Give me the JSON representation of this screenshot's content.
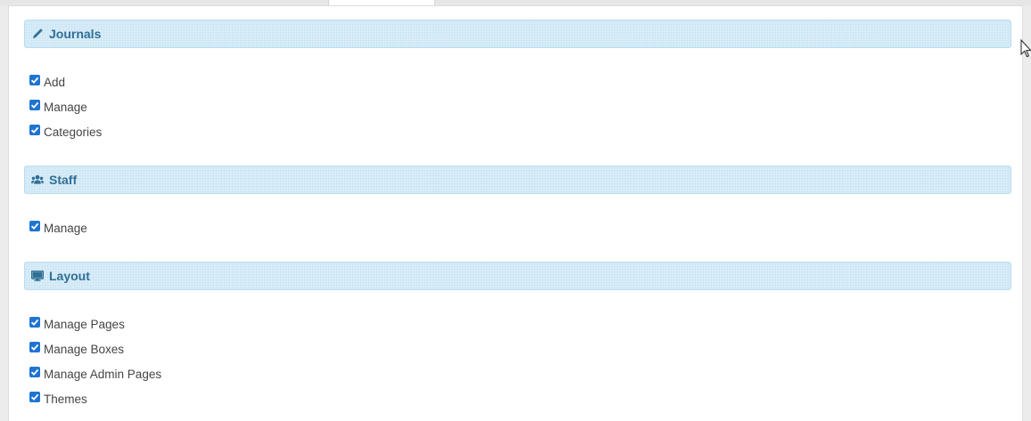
{
  "colors": {
    "header_bg": "#d9edf8",
    "header_border": "#b8dcf0",
    "header_text": "#2f6f95",
    "checkbox": "#1f74d2"
  },
  "sections": [
    {
      "title": "Journals",
      "icon": "pencil-icon",
      "items": [
        {
          "label": "Add",
          "checked": true
        },
        {
          "label": "Manage",
          "checked": true
        },
        {
          "label": "Categories",
          "checked": true
        }
      ]
    },
    {
      "title": "Staff",
      "icon": "users-icon",
      "items": [
        {
          "label": "Manage",
          "checked": true
        }
      ]
    },
    {
      "title": "Layout",
      "icon": "desktop-icon",
      "items": [
        {
          "label": "Manage Pages",
          "checked": true
        },
        {
          "label": "Manage Boxes",
          "checked": true
        },
        {
          "label": "Manage Admin Pages",
          "checked": true
        },
        {
          "label": "Themes",
          "checked": true
        }
      ]
    }
  ]
}
